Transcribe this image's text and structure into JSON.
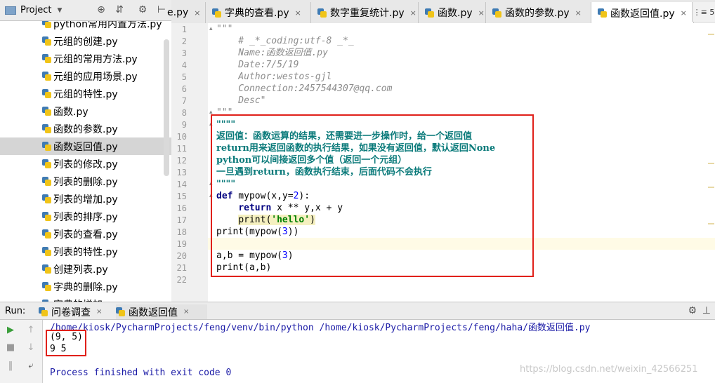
{
  "project_panel": {
    "title": "Project",
    "files": [
      {
        "name": "python常用内置方法.py"
      },
      {
        "name": "元组的创建.py"
      },
      {
        "name": "元组的常用方法.py"
      },
      {
        "name": "元组的应用场景.py"
      },
      {
        "name": "元组的特性.py"
      },
      {
        "name": "函数.py"
      },
      {
        "name": "函数的参数.py"
      },
      {
        "name": "函数返回值.py",
        "selected": true
      },
      {
        "name": "列表的修改.py"
      },
      {
        "name": "列表的删除.py"
      },
      {
        "name": "列表的增加.py"
      },
      {
        "name": "列表的排序.py"
      },
      {
        "name": "列表的查看.py"
      },
      {
        "name": "列表的特性.py"
      },
      {
        "name": "创建列表.py"
      },
      {
        "name": "字典的删除.py"
      },
      {
        "name": "字典的增加"
      }
    ]
  },
  "tabs": [
    {
      "label": "e.py"
    },
    {
      "label": "字典的查看.py"
    },
    {
      "label": "数字重复统计.py"
    },
    {
      "label": "函数.py"
    },
    {
      "label": "函数的参数.py"
    },
    {
      "label": "函数返回值.py",
      "active": true
    }
  ],
  "tab_overflow": "⋮≡ 5",
  "editor": {
    "line_numbers": [
      "1",
      "2",
      "3",
      "4",
      "5",
      "6",
      "7",
      "8",
      "9",
      "10",
      "11",
      "12",
      "13",
      "14",
      "15",
      "16",
      "17",
      "18",
      "19",
      "20",
      "21",
      "22"
    ],
    "lines": {
      "l1": "\"\"\"",
      "l2": "    # _*_coding:utf-8 _*_",
      "l3": "    Name:函数返回值.py",
      "l4": "    Date:7/5/19",
      "l5": "    Author:westos-gjl",
      "l6": "    Connection:2457544307@qq.com",
      "l7": "    Desc\"",
      "l8": "\"\"\"",
      "l9": "\"\"\"\"",
      "l10": "返回值：函数运算的结果，还需要进一步操作时，给一个返回值",
      "l11": "return用来返回函数的执行结果，如果没有返回值，默认返回None",
      "l12": "python可以间接返回多个值（返回一个元组）",
      "l13": "一旦遇到return，函数执行结束，后面代码不会执行",
      "l14": "\"\"\"\"",
      "l15_kw": "def",
      "l15_a": " mypow(x,y=",
      "l15_num": "2",
      "l15_b": "):",
      "l16_indent": "    ",
      "l16_kw": "return",
      "l16_rest": " x ** y,x + y",
      "l17_indent": "    ",
      "l17_a": "print(",
      "l17_str": "'hello'",
      "l17_b": ")",
      "l18_a": "print(mypow(",
      "l18_num": "3",
      "l18_b": "))",
      "l20_a": "a,b = mypow(",
      "l20_num": "3",
      "l20_b": ")",
      "l21": "print(a,b)"
    }
  },
  "run_panel": {
    "label": "Run:",
    "tabs": [
      {
        "label": "问卷调查"
      },
      {
        "label": "函数返回值",
        "active": true
      }
    ],
    "console": {
      "command": "/home/kiosk/PycharmProjects/feng/venv/bin/python /home/kiosk/PycharmProjects/feng/haha/函数返回值.py",
      "out1": "(9, 5)",
      "out2": "9 5",
      "finished": "Process finished with exit code 0"
    }
  },
  "watermark": "https://blog.csdn.net/weixin_42566251",
  "colors": {
    "highlight_box": "#e0201a",
    "keyword": "#000080",
    "docstring": "#0a7a7a",
    "string": "#008000",
    "number": "#0000ff"
  }
}
